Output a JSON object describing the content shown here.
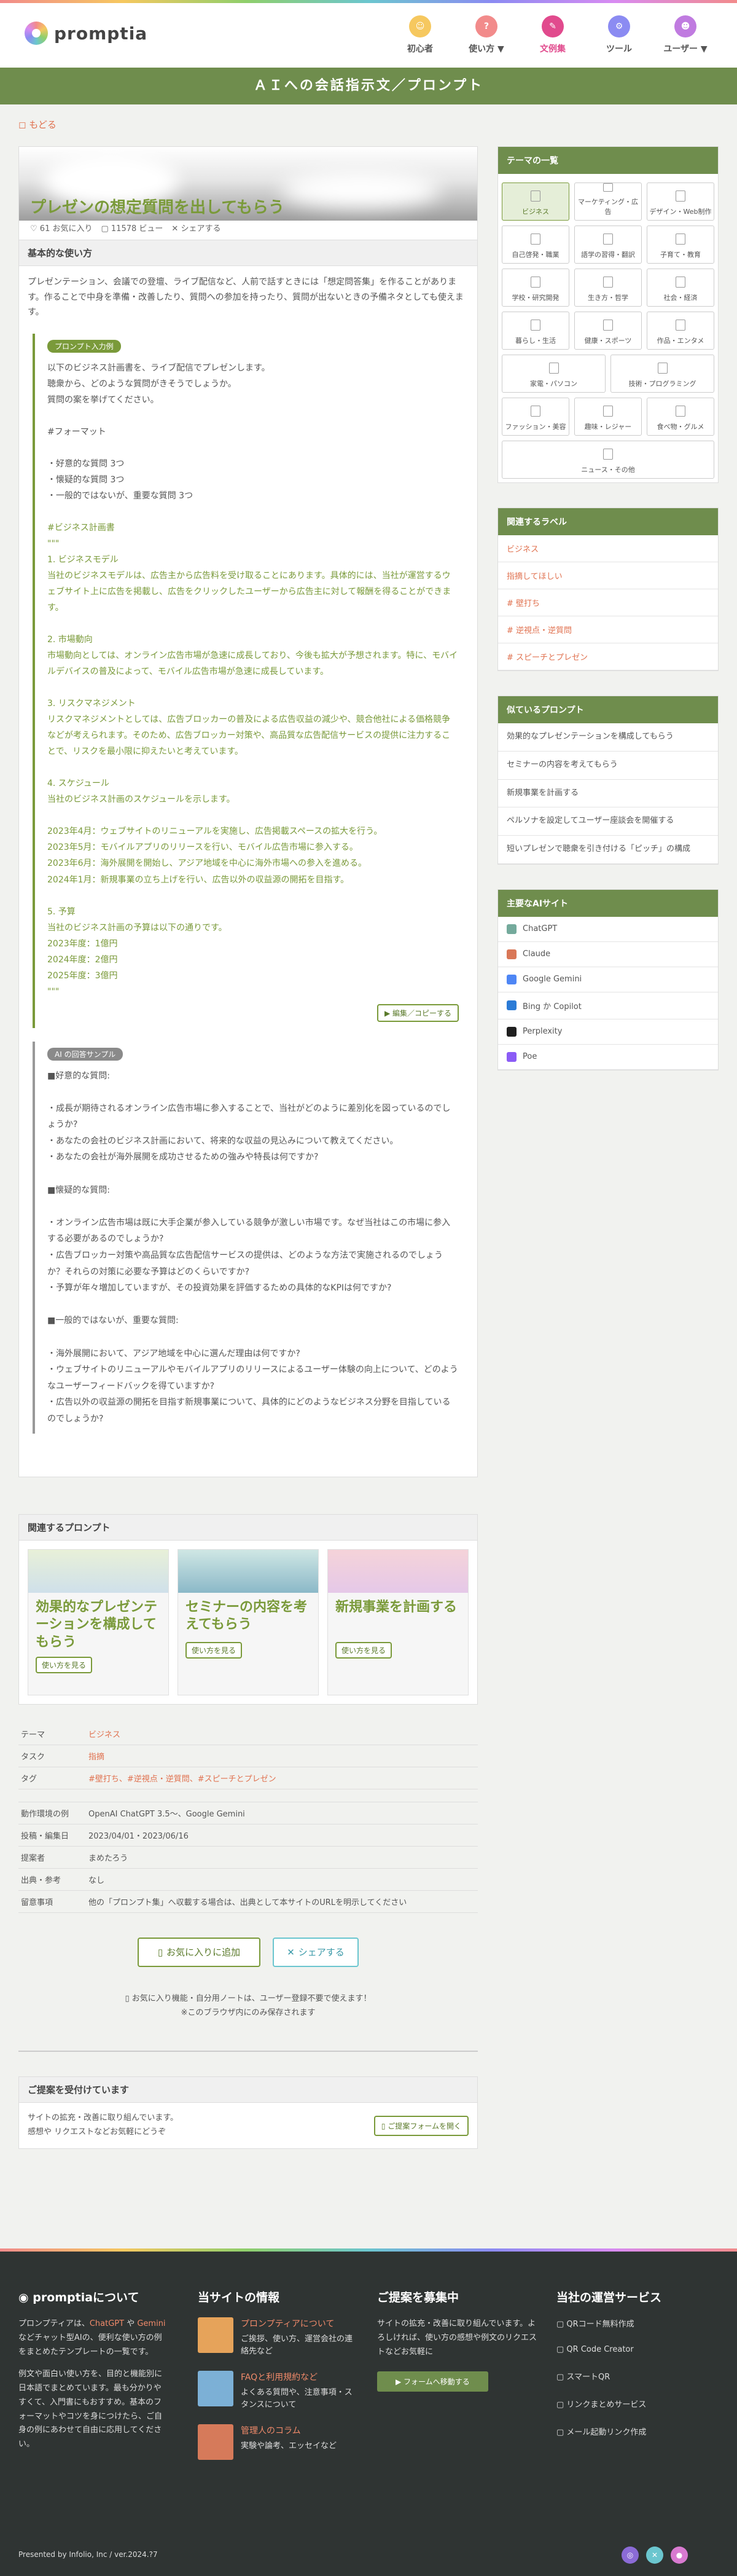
{
  "header": {
    "logo": "promptia",
    "nav": [
      {
        "label": "初心者",
        "color": "#f6c85f",
        "icon": "beginner-icon",
        "glyph": "☺"
      },
      {
        "label": "使い方 ▼",
        "color": "#f28b8b",
        "icon": "howto-icon",
        "glyph": "?"
      },
      {
        "label": "文例集",
        "color": "#e14a8d",
        "icon": "examples-icon",
        "glyph": "✎",
        "active": true
      },
      {
        "label": "ツール",
        "color": "#8b8bf2",
        "icon": "tool-icon",
        "glyph": "⚙"
      },
      {
        "label": "ユーザー ▼",
        "color": "#c07be0",
        "icon": "user-icon",
        "glyph": "☻"
      }
    ]
  },
  "title_bar": "ＡＩへの会話指示文／プロンプト",
  "back": "もどる",
  "hero": {
    "title": "プレゼンの想定質問を出してもらう",
    "favorites": "61 お気に入り",
    "views": "11578 ビュー",
    "share": "シェアする"
  },
  "usage": {
    "heading": "基本的な使い方",
    "body": "プレゼンテーション、会議での登壇、ライブ配信など、人前で話すときには「想定問答集」を作ることがあります。作ることで中身を準備・改善したり、質問への参加を持ったり、質問が出ないときの予備ネタとしても使えます。",
    "prompt_badge": "プロンプト入力例",
    "prompt_intro": "以下のビジネス計画書を、ライブ配信でプレゼンします。\n聴衆から、どのような質問がきそうでしょうか。\n質問の案を挙げてください。\n\n#フォーマット\n\n・好意的な質問 3つ\n・懐疑的な質問 3つ\n・一般的ではないが、重要な質問 3つ\n",
    "prompt_plan": "\n#ビジネス計画書\n\"\"\"\n1. ビジネスモデル\n当社のビジネスモデルは、広告主から広告料を受け取ることにあります。具体的には、当社が運営するウェブサイト上に広告を掲載し、広告をクリックしたユーザーから広告主に対して報酬を得ることができます。\n\n2. 市場動向\n市場動向としては、オンライン広告市場が急速に成長しており、今後も拡大が予想されます。特に、モバイルデバイスの普及によって、モバイル広告市場が急速に成長しています。\n\n3. リスクマネジメント\nリスクマネジメントとしては、広告ブロッカーの普及による広告収益の減少や、競合他社による価格競争などが考えられます。そのため、広告ブロッカー対策や、高品質な広告配信サービスの提供に注力することで、リスクを最小限に抑えたいと考えています。\n\n4. スケジュール\n当社のビジネス計画のスケジュールを示します。\n\n2023年4月：ウェブサイトのリニューアルを実施し、広告掲載スペースの拡大を行う。\n2023年5月：モバイルアプリのリリースを行い、モバイル広告市場に参入する。\n2023年6月：海外展開を開始し、アジア地域を中心に海外市場への参入を進める。\n2024年1月：新規事業の立ち上げを行い、広告以外の収益源の開拓を目指す。\n\n5. 予算\n当社のビジネス計画の予算は以下の通りです。\n2023年度：1億円\n2024年度：2億円\n2025年度：3億円\n\"\"\"",
    "edit_button": "編集／コピーする",
    "sample_badge": "AI の回答サンプル",
    "sample_text": "■好意的な質問:\n\n・成長が期待されるオンライン広告市場に参入することで、当社がどのように差別化を図っているのでしょうか?\n・あなたの会社のビジネス計画において、将来的な収益の見込みについて教えてください。\n・あなたの会社が海外展開を成功させるための強みや特長は何ですか?\n\n■懐疑的な質問:\n\n・オンライン広告市場は既に大手企業が参入している競争が激しい市場です。なぜ当社はこの市場に参入する必要があるのでしょうか?\n・広告ブロッカー対策や高品質な広告配信サービスの提供は、どのような方法で実施されるのでしょうか？それらの対策に必要な予算はどのくらいですか?\n・予算が年々増加していますが、その投資効果を評価するための具体的なKPIは何ですか?\n\n■一般的ではないが、重要な質問:\n\n・海外展開において、アジア地域を中心に選んだ理由は何ですか?\n・ウェブサイトのリニューアルやモバイルアプリのリリースによるユーザー体験の向上について、どのようなユーザーフィードバックを得ていますか?\n・広告以外の収益源の開拓を目指す新規事業について、具体的にどのようなビジネス分野を目指しているのでしょうか?"
  },
  "related": {
    "heading": "関連するプロンプト",
    "cards": [
      {
        "title": "効果的なプレゼンテーションを構成してもらう",
        "button": "使い方を見る"
      },
      {
        "title": "セミナーの内容を考えてもらう",
        "button": "使い方を見る"
      },
      {
        "title": "新規事業を計画する",
        "button": "使い方を見る"
      }
    ]
  },
  "info": {
    "theme_k": "テーマ",
    "theme_v": "ビジネス",
    "task_k": "タスク",
    "task_v": "指摘",
    "tag_k": "タグ",
    "tag_v": "#壁打ち、#逆視点・逆質問、#スピーチとプレゼン",
    "env_k": "動作環境の例",
    "env_v": "OpenAI ChatGPT 3.5～、Google Gemini",
    "date_k": "投稿・編集日",
    "date_v": "2023/04/01・2023/06/16",
    "author_k": "提案者",
    "author_v": "まめたろう",
    "source_k": "出典・参考",
    "source_v": "なし",
    "notes_k": "留意事項",
    "notes_v": "他の「プロンプト集」へ収載する場合は、出典として本サイトのURLを明示してください"
  },
  "actions": {
    "favorite": "お気に入りに追加",
    "share": "シェアする"
  },
  "note": {
    "line1": "お気に入り機能・自分用ノートは、ユーザー登録不要で使えます！",
    "line2": "※このブラウザ内にのみ保存されます"
  },
  "proposal": {
    "heading": "ご提案を受付けています",
    "body": "サイトの拡充・改善に取り組んでいます。\n感想や リクエストなどお気軽にどうぞ",
    "button": "ご提案フォームを開く"
  },
  "sidebar": {
    "themes_heading": "テーマの一覧",
    "themes": [
      {
        "label": "ビジネス",
        "span": "s3",
        "active": true
      },
      {
        "label": "マーケティング・広告",
        "span": "s3"
      },
      {
        "label": "デザイン・Web制作",
        "span": "s3"
      },
      {
        "label": "自己啓発・職業",
        "span": "s3"
      },
      {
        "label": "語学の習得・翻訳",
        "span": "s3"
      },
      {
        "label": "子育て・教育",
        "span": "s3"
      },
      {
        "label": "学校・研究開発",
        "span": "s3"
      },
      {
        "label": "生き方・哲学",
        "span": "s3"
      },
      {
        "label": "社会・経済",
        "span": "s3"
      },
      {
        "label": "暮らし・生活",
        "span": "s3"
      },
      {
        "label": "健康・スポーツ",
        "span": "s3"
      },
      {
        "label": "作品・エンタメ",
        "span": "s3"
      },
      {
        "label": "家電・パソコン",
        "span": "s2"
      },
      {
        "label": "技術・プログラミング",
        "span": "s2"
      },
      {
        "label": "ファッション・美容",
        "span": "s3"
      },
      {
        "label": "趣味・レジャー",
        "span": "s3"
      },
      {
        "label": "食べ物・グルメ",
        "span": "s3"
      },
      {
        "label": "ニュース・その他",
        "span": "s6"
      }
    ],
    "labels_heading": "関連するラベル",
    "labels": [
      "ビジネス",
      "指摘してほしい",
      "# 壁打ち",
      "# 逆視点・逆質問",
      "# スピーチとプレゼン"
    ],
    "similar_heading": "似ているプロンプト",
    "similar": [
      "効果的なプレゼンテーションを構成してもらう",
      "セミナーの内容を考えてもらう",
      "新規事業を計画する",
      "ペルソナを設定してユーザー座談会を開催する",
      "短いプレゼンで聴衆を引き付ける「ピッチ」の構成"
    ],
    "ai_heading": "主要なAIサイト",
    "ai": [
      {
        "label": "ChatGPT",
        "color": "#74aa9c"
      },
      {
        "label": "Claude",
        "color": "#d97757"
      },
      {
        "label": "Google Gemini",
        "color": "#4e86f5"
      },
      {
        "label": "Bing か Copilot",
        "color": "#2b7bd6"
      },
      {
        "label": "Perplexity",
        "color": "#1f1f1f"
      },
      {
        "label": "Poe",
        "color": "#8b5cf6"
      }
    ]
  },
  "footer": {
    "about_heading": "promptiaについて",
    "about_1": "プロンプティアは、",
    "about_chatgpt": "ChatGPT",
    "about_2": " や ",
    "about_gemini": "Gemini",
    "about_3": " などチャット型AIの、便利な使い方の例をまとめたテンプレートの一覧です。",
    "about_4": "例文や面白い使い方を、目的と機能別に日本語でまとめています。最も分かりやすくて、入門書にもおすすめ。基本のフォーマットやコツを身につけたら、ご自身の例にあわせて自由に応用してください。",
    "info_heading": "当サイトの情報",
    "info_items": [
      {
        "t1": "プロンプティアについて",
        "t2": "ご挨拶、使い方、運営会社の連絡先など",
        "color": "#e6a35a"
      },
      {
        "t1": "FAQと利用規約など",
        "t2": "よくある質問や、注意事項・スタンスについて",
        "color": "#7cb0d6"
      },
      {
        "t1": "管理人のコラム",
        "t2": "実験や論考、エッセイなど",
        "color": "#d67a5a"
      }
    ],
    "recruit_heading": "ご提案を募集中",
    "recruit_body": "サイトの拡充・改善に取り組んでいます。よろしければ、使い方の感想や例文のリクエストなどお気軽に",
    "recruit_button": "フォームへ移動する",
    "services_heading": "当社の運営サービス",
    "services": [
      "QRコード無料作成",
      "QR Code Creator",
      "スマートQR",
      "リンクまとめサービス",
      "メール起動リンク作成"
    ],
    "copyright": "Presented by Infolio, Inc / ver.2024.?7"
  }
}
